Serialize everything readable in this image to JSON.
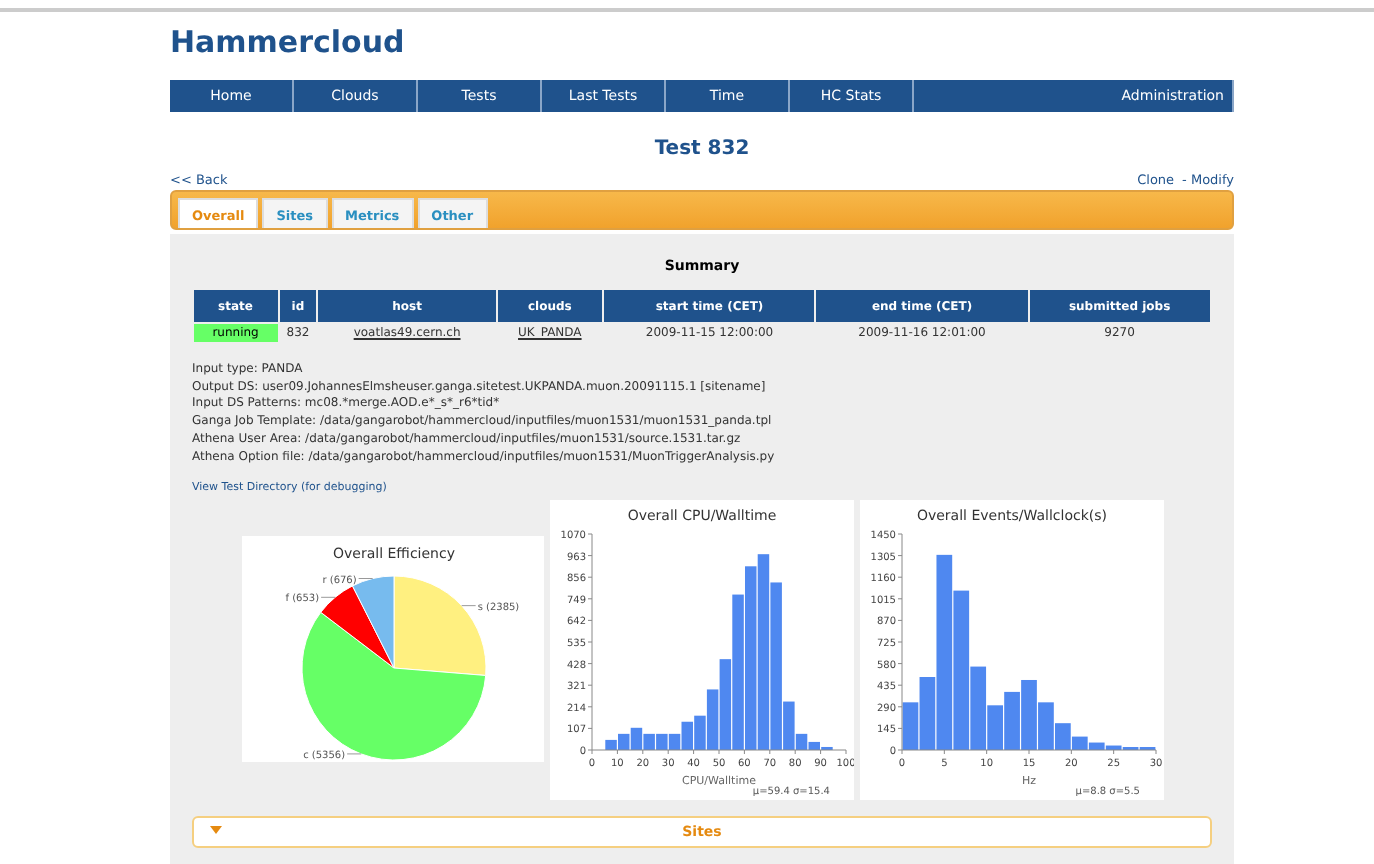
{
  "site_title": "Hammercloud",
  "nav": [
    {
      "label": "Home"
    },
    {
      "label": "Clouds"
    },
    {
      "label": "Tests"
    },
    {
      "label": "Last Tests"
    },
    {
      "label": "Time"
    },
    {
      "label": "HC Stats"
    },
    {
      "label": "Administration"
    }
  ],
  "page_title": "Test 832",
  "back_link": "<< Back",
  "actions": [
    "Clone",
    "- Modify"
  ],
  "tabs": [
    {
      "label": "Overall",
      "selected": true
    },
    {
      "label": "Sites",
      "selected": false
    },
    {
      "label": "Metrics",
      "selected": false
    },
    {
      "label": "Other",
      "selected": false
    }
  ],
  "summary": {
    "title": "Summary",
    "columns": [
      "state",
      "id",
      "host",
      "clouds",
      "start time (CET)",
      "end time (CET)",
      "submitted jobs"
    ],
    "row": {
      "state": "running",
      "color": "#66ff66",
      "id": "832",
      "host": "voatlas49.cern.ch",
      "clouds": "UK_PANDA",
      "start": "2009-11-15 12:00:00",
      "end": "2009-11-16 12:01:00",
      "jobs": "9270"
    }
  },
  "info_lines": [
    "Input type: PANDA",
    "Output DS: user09.JohannesElmsheuser.ganga.sitetest.UKPANDA.muon.20091115.1 [sitename]",
    "Input DS Patterns: mc08.*merge.AOD.e*_s*_r6*tid*",
    "Ganga Job Template: /data/gangarobot/hammercloud/inputfiles/muon1531/muon1531_panda.tpl",
    "Athena User Area: /data/gangarobot/hammercloud/inputfiles/muon1531/source.1531.tar.gz",
    "Athena Option file: /data/gangarobot/hammercloud/inputfiles/muon1531/MuonTriggerAnalysis.py"
  ],
  "debug_link": "View Test Directory (for debugging)",
  "charts": [
    {
      "chart_data": {
        "type": "pie",
        "title": "Overall Efficiency",
        "categories": [
          "s (2385)",
          "c (5356)",
          "f (653)",
          "r (676)"
        ],
        "values": [
          2385,
          5356,
          653,
          676
        ],
        "colors": [
          "#fff080",
          "#66ff66",
          "#ff0000",
          "#77bbee"
        ]
      }
    },
    {
      "chart_data": {
        "type": "bar",
        "title": "Overall CPU/Walltime",
        "xlabel": "CPU/Walltime",
        "x": [
          7.5,
          12.5,
          17.5,
          22.5,
          27.5,
          32.5,
          37.5,
          42.5,
          47.5,
          52.5,
          57.5,
          62.5,
          67.5,
          72.5,
          77.5,
          82.5,
          87.5,
          92.5
        ],
        "series": [
          {
            "color": "#4f88f0",
            "values": [
              50,
              80,
              110,
              80,
              80,
              80,
              140,
              170,
              300,
              450,
              770,
              910,
              970,
              830,
              240,
              80,
              40,
              15
            ]
          }
        ],
        "xlim": [
          0,
          100
        ],
        "ylim": [
          0,
          1070
        ],
        "xticks": [
          0,
          10,
          20,
          30,
          40,
          50,
          60,
          70,
          80,
          90,
          100
        ],
        "yticks": [
          0,
          107,
          214,
          321,
          428,
          535,
          642,
          749,
          856,
          963,
          1070
        ]
      },
      "note": "μ=59.4 σ=15.4"
    },
    {
      "chart_data": {
        "type": "bar",
        "title": "Overall Events/Wallclock(s)",
        "xlabel": "Hz",
        "x": [
          1,
          3,
          5,
          7,
          9,
          11,
          13,
          15,
          17,
          19,
          21,
          23,
          25,
          27,
          29
        ],
        "series": [
          {
            "color": "#4f88f0",
            "values": [
              320,
              490,
              1310,
              1070,
              560,
              300,
              390,
              470,
              320,
              180,
              90,
              50,
              30,
              20,
              20
            ]
          }
        ],
        "xlim": [
          0,
          30
        ],
        "ylim": [
          0,
          1450
        ],
        "xticks": [
          0,
          5,
          10,
          15,
          20,
          25,
          30
        ],
        "yticks": [
          0,
          145,
          290,
          435,
          580,
          725,
          870,
          1015,
          1160,
          1305,
          1450
        ]
      },
      "note": "μ=8.8 σ=5.5"
    }
  ],
  "section": {
    "title": "Sites",
    "expanded": true
  }
}
